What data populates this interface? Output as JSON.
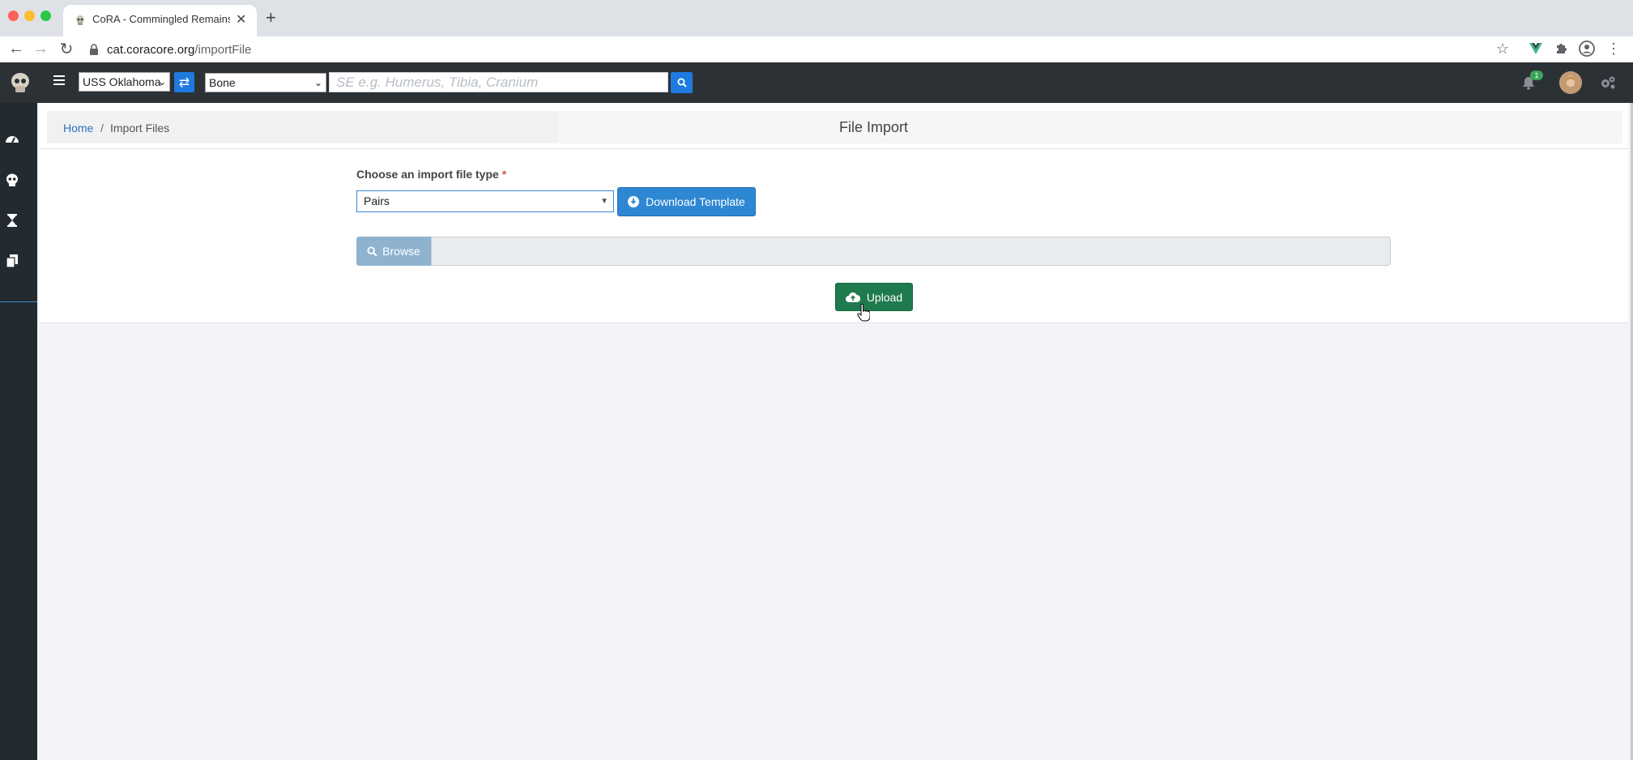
{
  "browser": {
    "tab_title": "CoRA - Commingled Remains /",
    "url_host": "cat.coracore.org",
    "url_path": "/importFile"
  },
  "header": {
    "project_select": "USS Oklahoma",
    "category_select": "Bone",
    "search_placeholder": "SE e.g. Humerus, Tibia, Cranium",
    "notification_count": "1"
  },
  "breadcrumb": {
    "home": "Home",
    "separator": "/",
    "current": "Import Files"
  },
  "page": {
    "title": "File Import",
    "field_label": "Choose an import file type",
    "required_mark": "*",
    "file_type_value": "Pairs",
    "download_label": "Download Template",
    "browse_label": "Browse",
    "upload_label": "Upload"
  },
  "colors": {
    "primary": "#2d87d2",
    "success": "#1f7a4d",
    "appbar": "#2c3136",
    "sidebar": "#232a30"
  },
  "icons": [
    "dashboard-icon",
    "skull-icon",
    "hourglass-icon",
    "copy-icon",
    "bell-icon",
    "gears-icon",
    "search-icon",
    "download-icon",
    "upload-cloud-icon"
  ]
}
